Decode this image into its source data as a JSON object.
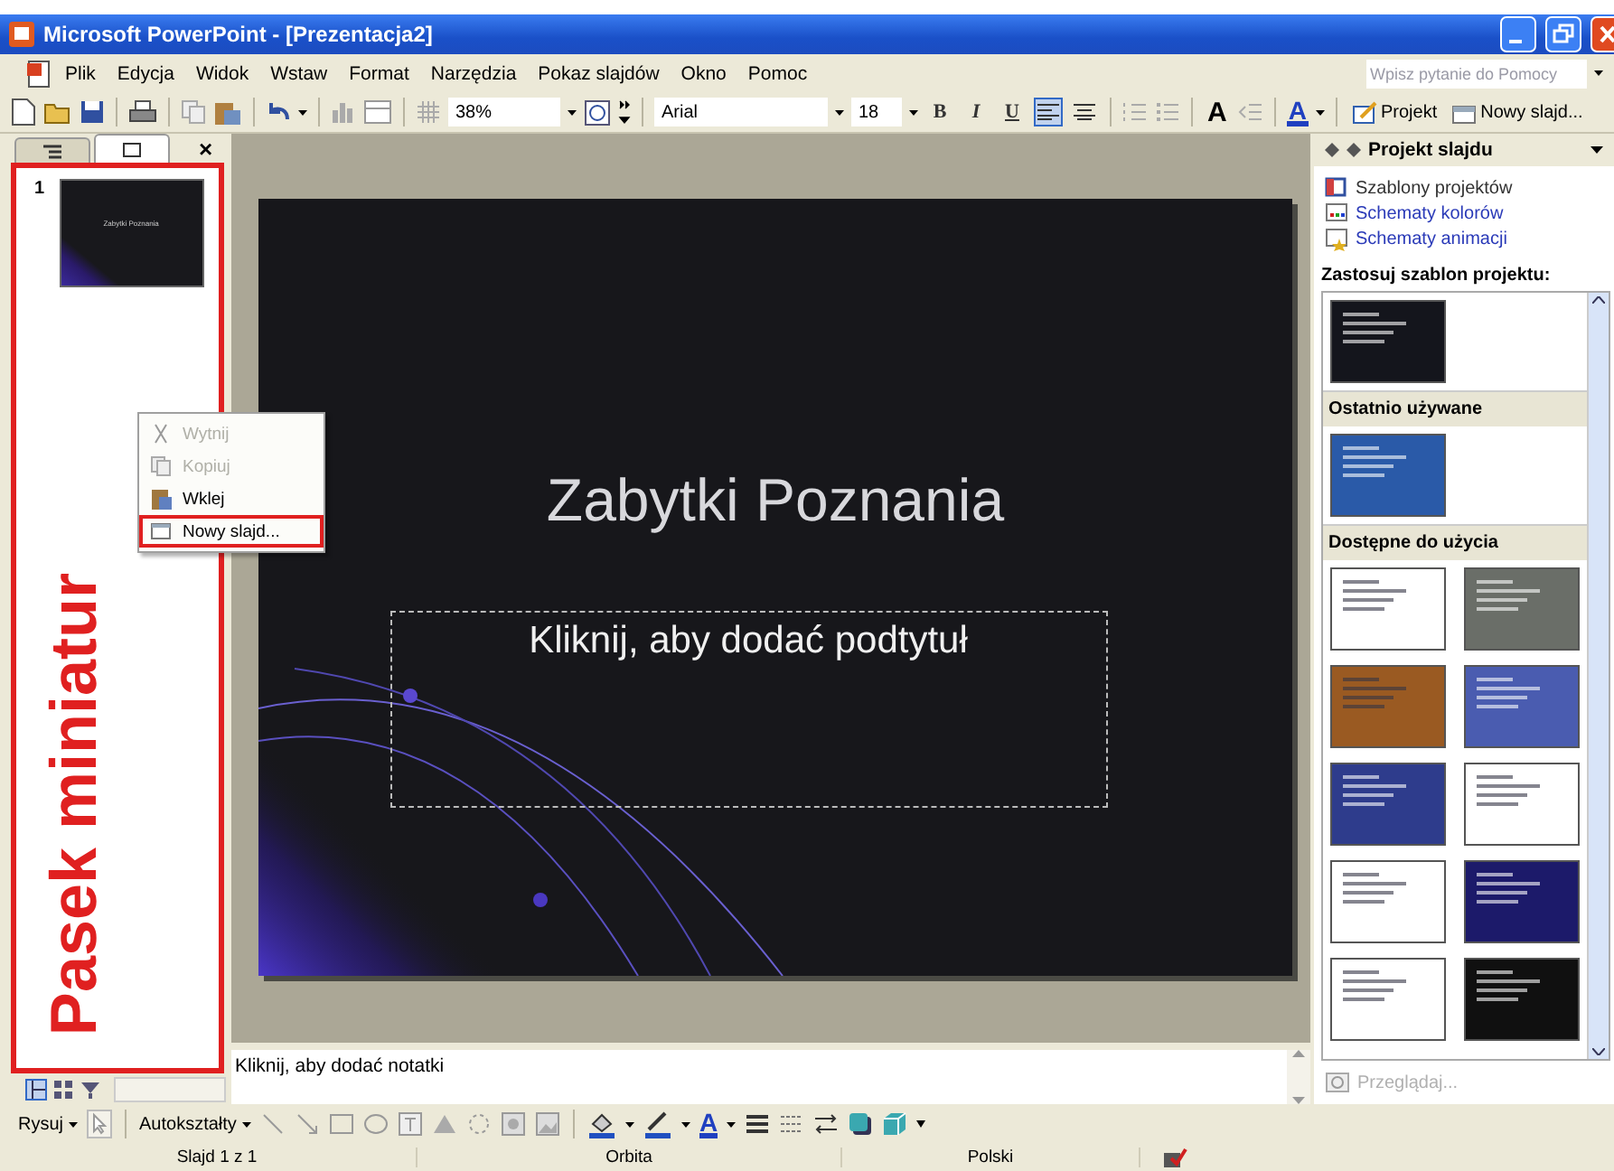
{
  "window": {
    "title": "Microsoft PowerPoint - [Prezentacja2]"
  },
  "menu": [
    "Plik",
    "Edycja",
    "Widok",
    "Wstaw",
    "Format",
    "Narzędzia",
    "Pokaz slajdów",
    "Okno",
    "Pomoc"
  ],
  "help_box": {
    "placeholder": "Wpisz pytanie do Pomocy"
  },
  "toolbar": {
    "zoom": "38%",
    "font": "Arial",
    "font_size": "18",
    "format_buttons": [
      {
        "label": "B",
        "kind": "bold"
      },
      {
        "label": "I",
        "kind": "italic"
      },
      {
        "label": "U",
        "kind": "underline"
      }
    ],
    "align_buttons": [
      {
        "selected": true
      },
      {
        "selected": false
      }
    ],
    "grow_font": "A",
    "font_color": "A",
    "buttons": [
      {
        "label": "Projekt",
        "kind": "design"
      },
      {
        "label": "Nowy slajd...",
        "kind": "new-slide"
      }
    ]
  },
  "pane_tabs": [
    {
      "selected": false,
      "kind": "outline"
    },
    {
      "selected": true,
      "kind": "slides"
    }
  ],
  "pane_close": "×",
  "slides": [
    {
      "number": "1",
      "title": "Zabytki Poznania"
    }
  ],
  "annotation": {
    "label": "Pasek miniatur"
  },
  "context_menu": [
    {
      "label": "Wytnij",
      "kind": "cut",
      "disabled": true,
      "annotated": false
    },
    {
      "label": "Kopiuj",
      "kind": "copy",
      "disabled": true,
      "annotated": false
    },
    {
      "label": "Wklej",
      "kind": "paste",
      "disabled": false,
      "annotated": false
    },
    {
      "label": "Nowy slajd...",
      "kind": "new-slide",
      "disabled": false,
      "annotated": true
    }
  ],
  "slide": {
    "title": "Zabytki Poznania",
    "subtitle_placeholder": "Kliknij, aby dodać podtytuł"
  },
  "notes": {
    "placeholder": "Kliknij, aby dodać notatki"
  },
  "task_pane": {
    "title": "Projekt slajdu",
    "links": [
      {
        "label": "Szablony projektów",
        "current": true
      },
      {
        "label": "Schematy kolorów",
        "current": false
      },
      {
        "label": "Schematy animacji",
        "current": false
      }
    ],
    "section": "Zastosuj szablon projektu:",
    "in_use": [
      {
        "color": "#14151c"
      }
    ],
    "groups": [
      {
        "heading": "Ostatnio używane",
        "templates": [
          {
            "color": "#2a5aa8"
          }
        ]
      },
      {
        "heading": "Dostępne do użycia",
        "templates": [
          {
            "color": "#ffffff"
          },
          {
            "color": "#6a6e68"
          },
          {
            "color": "#9a5a22"
          },
          {
            "color": "#4a5cb0"
          },
          {
            "color": "#2e3c8c"
          },
          {
            "color": "#ffffff"
          },
          {
            "color": "#ffffff"
          },
          {
            "color": "#1c1a6a"
          },
          {
            "color": "#ffffff"
          },
          {
            "color": "#101010"
          }
        ]
      }
    ],
    "browse": {
      "label": "Przeglądaj...",
      "disabled": true
    }
  },
  "drawing_toolbar": {
    "draw": "Rysuj",
    "autoshapes": "Autokształty",
    "font_color": "A"
  },
  "status_bar": [
    "Slajd 1 z 1",
    "Orbita",
    "Polski"
  ]
}
